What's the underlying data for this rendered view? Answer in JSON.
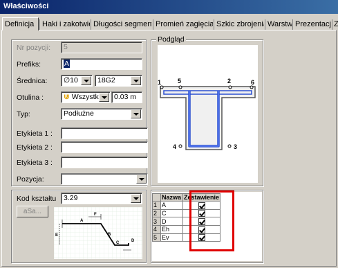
{
  "window": {
    "title": "Właściwości"
  },
  "tabs": [
    "Definicja",
    "Haki i zakotwienie",
    "Długości segmentów",
    "Promień zagięcia",
    "Szkic zbrojenia",
    "Warstwy",
    "Prezentacja",
    "Zakład"
  ],
  "form": {
    "nr_label": "Nr pozycji:",
    "nr_value": "5",
    "prefix_label": "Prefiks:",
    "prefix_value": "A",
    "diameter_label": "Średnica:",
    "diameter_value": "∅10",
    "steel_value": "18G2",
    "cover_label": "Otulina :",
    "cover_mode": "Wszystko",
    "cover_value": "0.03 m",
    "type_label": "Typ:",
    "type_value": "Podłużne",
    "tag1_label": "Etykieta 1 :",
    "tag2_label": "Etykieta 2 :",
    "tag3_label": "Etykieta 3 :",
    "position_label": "Pozycja:"
  },
  "preview": {
    "label": "Podgląd",
    "points": [
      "1",
      "5",
      "2",
      "6",
      "4",
      "3"
    ]
  },
  "shape": {
    "label": "Kod kształtu",
    "value": "3.29",
    "button": "aSa...",
    "sketch_labels": [
      "A",
      "B",
      "C",
      "D",
      "E",
      "F"
    ]
  },
  "segments_table": {
    "headers": [
      "",
      "Nazwa",
      "Zestawienie"
    ],
    "rows": [
      {
        "no": "1",
        "name": "A",
        "checked": true
      },
      {
        "no": "2",
        "name": "C",
        "checked": true
      },
      {
        "no": "3",
        "name": "D",
        "checked": true
      },
      {
        "no": "4",
        "name": "Eh",
        "checked": true
      },
      {
        "no": "5",
        "name": "Ev",
        "checked": true
      }
    ]
  },
  "colors": {
    "highlight": "#e00000",
    "rebar": "#2a4fd0",
    "concrete": "#555555"
  }
}
